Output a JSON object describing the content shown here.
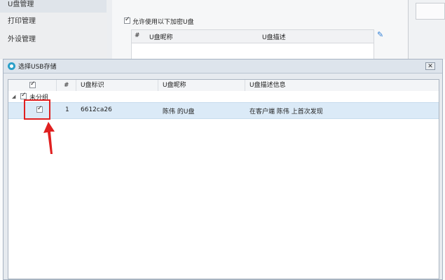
{
  "sidebar": {
    "items": [
      {
        "label": "U盘管理",
        "selected": true
      },
      {
        "label": "打印管理",
        "selected": false
      },
      {
        "label": "外设管理",
        "selected": false
      }
    ]
  },
  "panel": {
    "allow_label": "允许使用以下加密U盘",
    "allow_checked": true,
    "table_headers": [
      "#",
      "U盘昵称",
      "U盘描述"
    ],
    "edit_icon": "pencil-icon"
  },
  "dialog": {
    "title": "选择USB存储",
    "title_icon": "refresh-circle-icon",
    "close_label": "✕",
    "columns": [
      "#",
      "U盘标识",
      "U盘昵称",
      "U盘描述信息"
    ],
    "group": {
      "label": "未分组",
      "checked": true,
      "expanded": true
    },
    "rows": [
      {
        "checked": true,
        "index": "1",
        "id": "6612ca26",
        "nickname": "陈伟 的U盘",
        "description": "在客户端 陈伟 上首次发现"
      }
    ]
  },
  "annotation": {
    "color": "#e02020"
  }
}
